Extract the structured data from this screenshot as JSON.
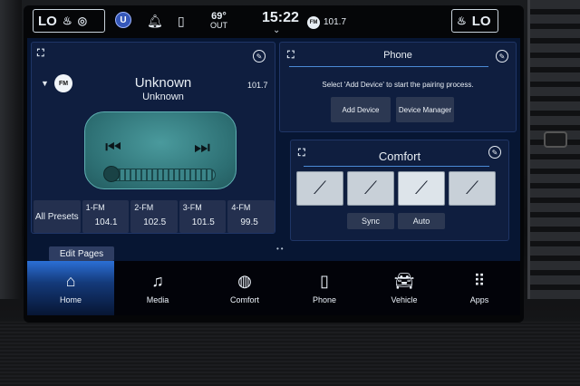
{
  "status_bar": {
    "left_temp": "LO",
    "right_temp": "LO",
    "outside_temp_value": "69°",
    "outside_temp_label": "OUT",
    "clock": "15:22",
    "radio_badge": "FM",
    "radio_freq": "101.7",
    "uconnect_badge": "U"
  },
  "radio": {
    "band_badge": "FM",
    "title": "Unknown",
    "artist": "Unknown",
    "frequency": "101.7",
    "all_presets_label": "All Presets",
    "presets": [
      {
        "name": "1-FM",
        "freq": "104.1"
      },
      {
        "name": "2-FM",
        "freq": "102.5"
      },
      {
        "name": "3-FM",
        "freq": "101.5"
      },
      {
        "name": "4-FM",
        "freq": "99.5"
      }
    ]
  },
  "phone": {
    "title": "Phone",
    "message": "Select 'Add Device' to start the pairing process.",
    "add_device_label": "Add Device",
    "device_manager_label": "Device Manager"
  },
  "comfort": {
    "title": "Comfort",
    "sync_label": "Sync",
    "auto_label": "Auto"
  },
  "nav": {
    "edit_pages_label": "Edit Pages",
    "items": [
      {
        "label": "Home",
        "icon": "home-icon"
      },
      {
        "label": "Media",
        "icon": "music-note-icon"
      },
      {
        "label": "Comfort",
        "icon": "comfort-icon"
      },
      {
        "label": "Phone",
        "icon": "phone-icon"
      },
      {
        "label": "Vehicle",
        "icon": "car-icon"
      },
      {
        "label": "Apps",
        "icon": "apps-grid-icon"
      }
    ]
  },
  "colors": {
    "accent": "#2b6fd6",
    "panel": "#0f1e3f",
    "background": "#071633"
  }
}
